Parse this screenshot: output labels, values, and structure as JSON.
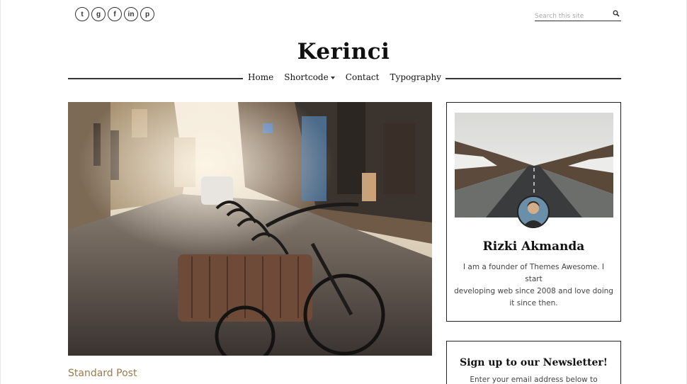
{
  "header": {
    "social": [
      {
        "icon": "twitter-icon",
        "glyph": "t"
      },
      {
        "icon": "google-plus-icon",
        "glyph": "g"
      },
      {
        "icon": "facebook-icon",
        "glyph": "f"
      },
      {
        "icon": "linkedin-icon",
        "glyph": "in"
      },
      {
        "icon": "pinterest-icon",
        "glyph": "p"
      }
    ],
    "search_placeholder": "Search this site",
    "site_title": "Kerinci"
  },
  "nav": {
    "items": [
      {
        "label": "Home"
      },
      {
        "label": "Shortcode",
        "has_dropdown": true
      },
      {
        "label": "Contact"
      },
      {
        "label": "Typography"
      }
    ]
  },
  "main": {
    "post_category": "Standard Post"
  },
  "sidebar": {
    "author_name": "Rizki Akmanda",
    "author_bio_lines": [
      "I am a founder of Themes Awesome. I start",
      "developing web since 2008 and love doing",
      "it since then."
    ],
    "newsletter_title": "Sign up to our Newsletter!",
    "newsletter_text": "Enter your email address below to"
  },
  "colors": {
    "accent": "#9a7a4e",
    "border": "#222222"
  }
}
